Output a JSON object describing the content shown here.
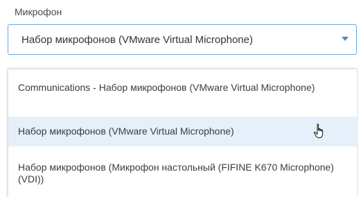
{
  "microphone": {
    "label": "Микрофон",
    "selected_value": "Набор микрофонов (VMware Virtual Microphone)",
    "options": [
      {
        "label": "Communications - Набор микрофонов (VMware Virtual Microphone)"
      },
      {
        "label": "Набор микрофонов (VMware Virtual Microphone)"
      },
      {
        "label": "Набор микрофонов (Микрофон настольный (FIFINE K670 Microphone) (VDI))"
      }
    ]
  },
  "icons": {
    "caret": "chevron-down-icon",
    "cursor": "hand-pointer-icon"
  },
  "colors": {
    "accent": "#3a8fd8",
    "select_border": "#6aa8e0",
    "hover_bg": "#e6f0fb"
  }
}
